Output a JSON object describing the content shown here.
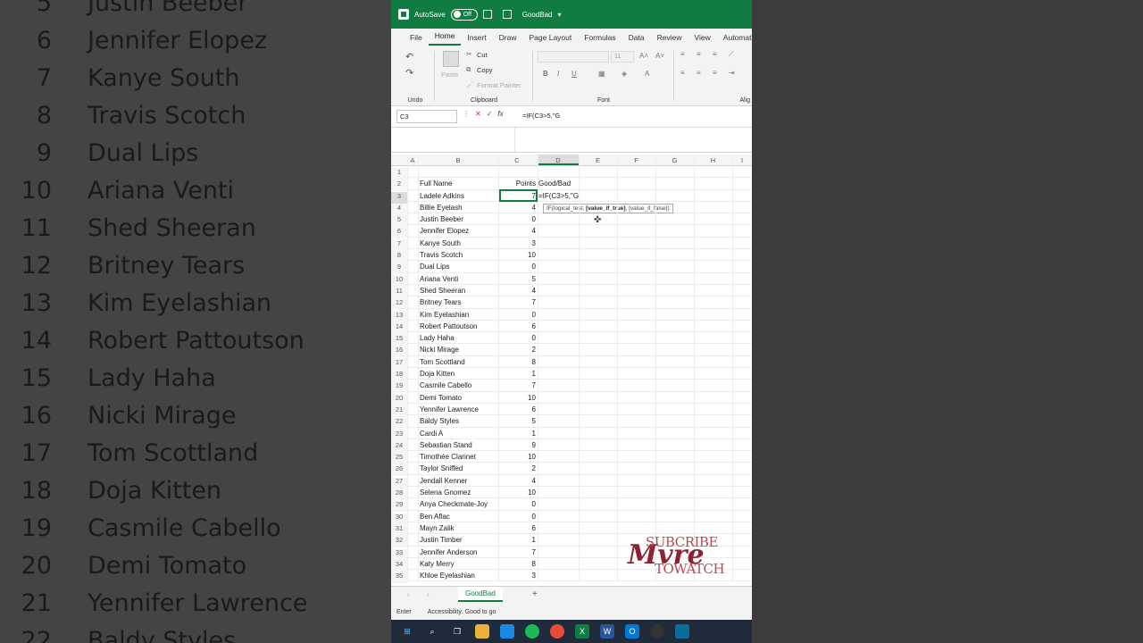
{
  "background": {
    "left_rows": [
      {
        "n": "5",
        "t": "Justin Beeber"
      },
      {
        "n": "6",
        "t": "Jennifer Elopez"
      },
      {
        "n": "7",
        "t": "Kanye South"
      },
      {
        "n": "8",
        "t": "Travis Scotch"
      },
      {
        "n": "9",
        "t": "Dual Lips"
      },
      {
        "n": "10",
        "t": "Ariana Venti"
      },
      {
        "n": "11",
        "t": "Shed Sheeran"
      },
      {
        "n": "12",
        "t": "Britney Tears"
      },
      {
        "n": "13",
        "t": "Kim Eyelashian"
      },
      {
        "n": "14",
        "t": "Robert Pattoutson"
      },
      {
        "n": "15",
        "t": "Lady Haha"
      },
      {
        "n": "16",
        "t": "Nicki Mirage"
      },
      {
        "n": "17",
        "t": "Tom Scottland"
      },
      {
        "n": "18",
        "t": "Doja Kitten"
      },
      {
        "n": "19",
        "t": "Casmile Cabello"
      },
      {
        "n": "20",
        "t": "Demi Tomato"
      },
      {
        "n": "21",
        "t": "Yennifer Lawrence"
      },
      {
        "n": "22",
        "t": "Baldy Styles"
      }
    ]
  },
  "titlebar": {
    "autosave": "AutoSave",
    "toggle": "Off",
    "filename": "GoodBad"
  },
  "menu": [
    "File",
    "Home",
    "Insert",
    "Draw",
    "Page Layout",
    "Formulas",
    "Data",
    "Review",
    "View",
    "Automate"
  ],
  "ribbon": {
    "undo_label": "Undo",
    "paste": "Paste",
    "cut": "Cut",
    "copy": "Copy",
    "format_painter": "Format Painter",
    "clipboard_label": "Clipboard",
    "font_size": "11",
    "font_label": "Font",
    "align_label": "Alig"
  },
  "formula": {
    "namebox": "C3",
    "text": "=IF(C3>5,\"G"
  },
  "columns": [
    "A",
    "B",
    "C",
    "D",
    "E",
    "F",
    "G",
    "H",
    "I"
  ],
  "rows": [
    {
      "n": "1",
      "b": "",
      "c": "",
      "d": ""
    },
    {
      "n": "2",
      "b": "Full Name",
      "c": "Points",
      "d": "Good/Bad"
    },
    {
      "n": "3",
      "b": "Ladele Adkins",
      "c": "7",
      "d": "=IF(C3>5,\"G"
    },
    {
      "n": "4",
      "b": "Billie Eyelash",
      "c": "4",
      "d": ""
    },
    {
      "n": "5",
      "b": "Justin Beeber",
      "c": "0",
      "d": ""
    },
    {
      "n": "6",
      "b": "Jennifer Elopez",
      "c": "4",
      "d": ""
    },
    {
      "n": "7",
      "b": "Kanye South",
      "c": "3",
      "d": ""
    },
    {
      "n": "8",
      "b": "Travis Scotch",
      "c": "10",
      "d": ""
    },
    {
      "n": "9",
      "b": "Dual Lips",
      "c": "0",
      "d": ""
    },
    {
      "n": "10",
      "b": "Ariana Venti",
      "c": "5",
      "d": ""
    },
    {
      "n": "11",
      "b": "Shed Sheeran",
      "c": "4",
      "d": ""
    },
    {
      "n": "12",
      "b": "Britney Tears",
      "c": "7",
      "d": ""
    },
    {
      "n": "13",
      "b": "Kim Eyelashian",
      "c": "0",
      "d": ""
    },
    {
      "n": "14",
      "b": "Robert Pattoutson",
      "c": "6",
      "d": ""
    },
    {
      "n": "15",
      "b": "Lady Haha",
      "c": "0",
      "d": ""
    },
    {
      "n": "16",
      "b": "Nicki Mirage",
      "c": "2",
      "d": ""
    },
    {
      "n": "17",
      "b": "Tom Scottland",
      "c": "8",
      "d": ""
    },
    {
      "n": "18",
      "b": "Doja Kitten",
      "c": "1",
      "d": ""
    },
    {
      "n": "19",
      "b": "Casmile Cabello",
      "c": "7",
      "d": ""
    },
    {
      "n": "20",
      "b": "Demi Tomato",
      "c": "10",
      "d": ""
    },
    {
      "n": "21",
      "b": "Yennifer Lawrence",
      "c": "6",
      "d": ""
    },
    {
      "n": "22",
      "b": "Baldy Styles",
      "c": "5",
      "d": ""
    },
    {
      "n": "23",
      "b": "Cardi A",
      "c": "1",
      "d": ""
    },
    {
      "n": "24",
      "b": "Sebastian Stand",
      "c": "9",
      "d": ""
    },
    {
      "n": "25",
      "b": "Timothée Clarinet",
      "c": "10",
      "d": ""
    },
    {
      "n": "26",
      "b": "Taylor Sniffed",
      "c": "2",
      "d": ""
    },
    {
      "n": "27",
      "b": "Jendall Kenner",
      "c": "4",
      "d": ""
    },
    {
      "n": "28",
      "b": "Selena Gnomez",
      "c": "10",
      "d": ""
    },
    {
      "n": "29",
      "b": "Anya Checkmate-Joy",
      "c": "0",
      "d": ""
    },
    {
      "n": "30",
      "b": "Ben Aflac",
      "c": "0",
      "d": ""
    },
    {
      "n": "31",
      "b": "Mayn Zalik",
      "c": "6",
      "d": ""
    },
    {
      "n": "32",
      "b": "Justin Timber",
      "c": "1",
      "d": ""
    },
    {
      "n": "33",
      "b": "Jennifer Anderson",
      "c": "7",
      "d": ""
    },
    {
      "n": "34",
      "b": "Katy Merry",
      "c": "8",
      "d": ""
    },
    {
      "n": "35",
      "b": "Khloe Eyelashian",
      "c": "3",
      "d": ""
    }
  ],
  "tooltip": {
    "pre": "IF(logical_test, ",
    "bold": "[value_if_true]",
    "post": ", [value_if_false])"
  },
  "sheet_tab": "GoodBad",
  "status": {
    "mode": "Enter",
    "accessibility": "Accessibility: Good to go"
  },
  "watermark": {
    "line1": "SUBCRIBE",
    "line2": "Mvre",
    "line3": "TOWATCH"
  }
}
